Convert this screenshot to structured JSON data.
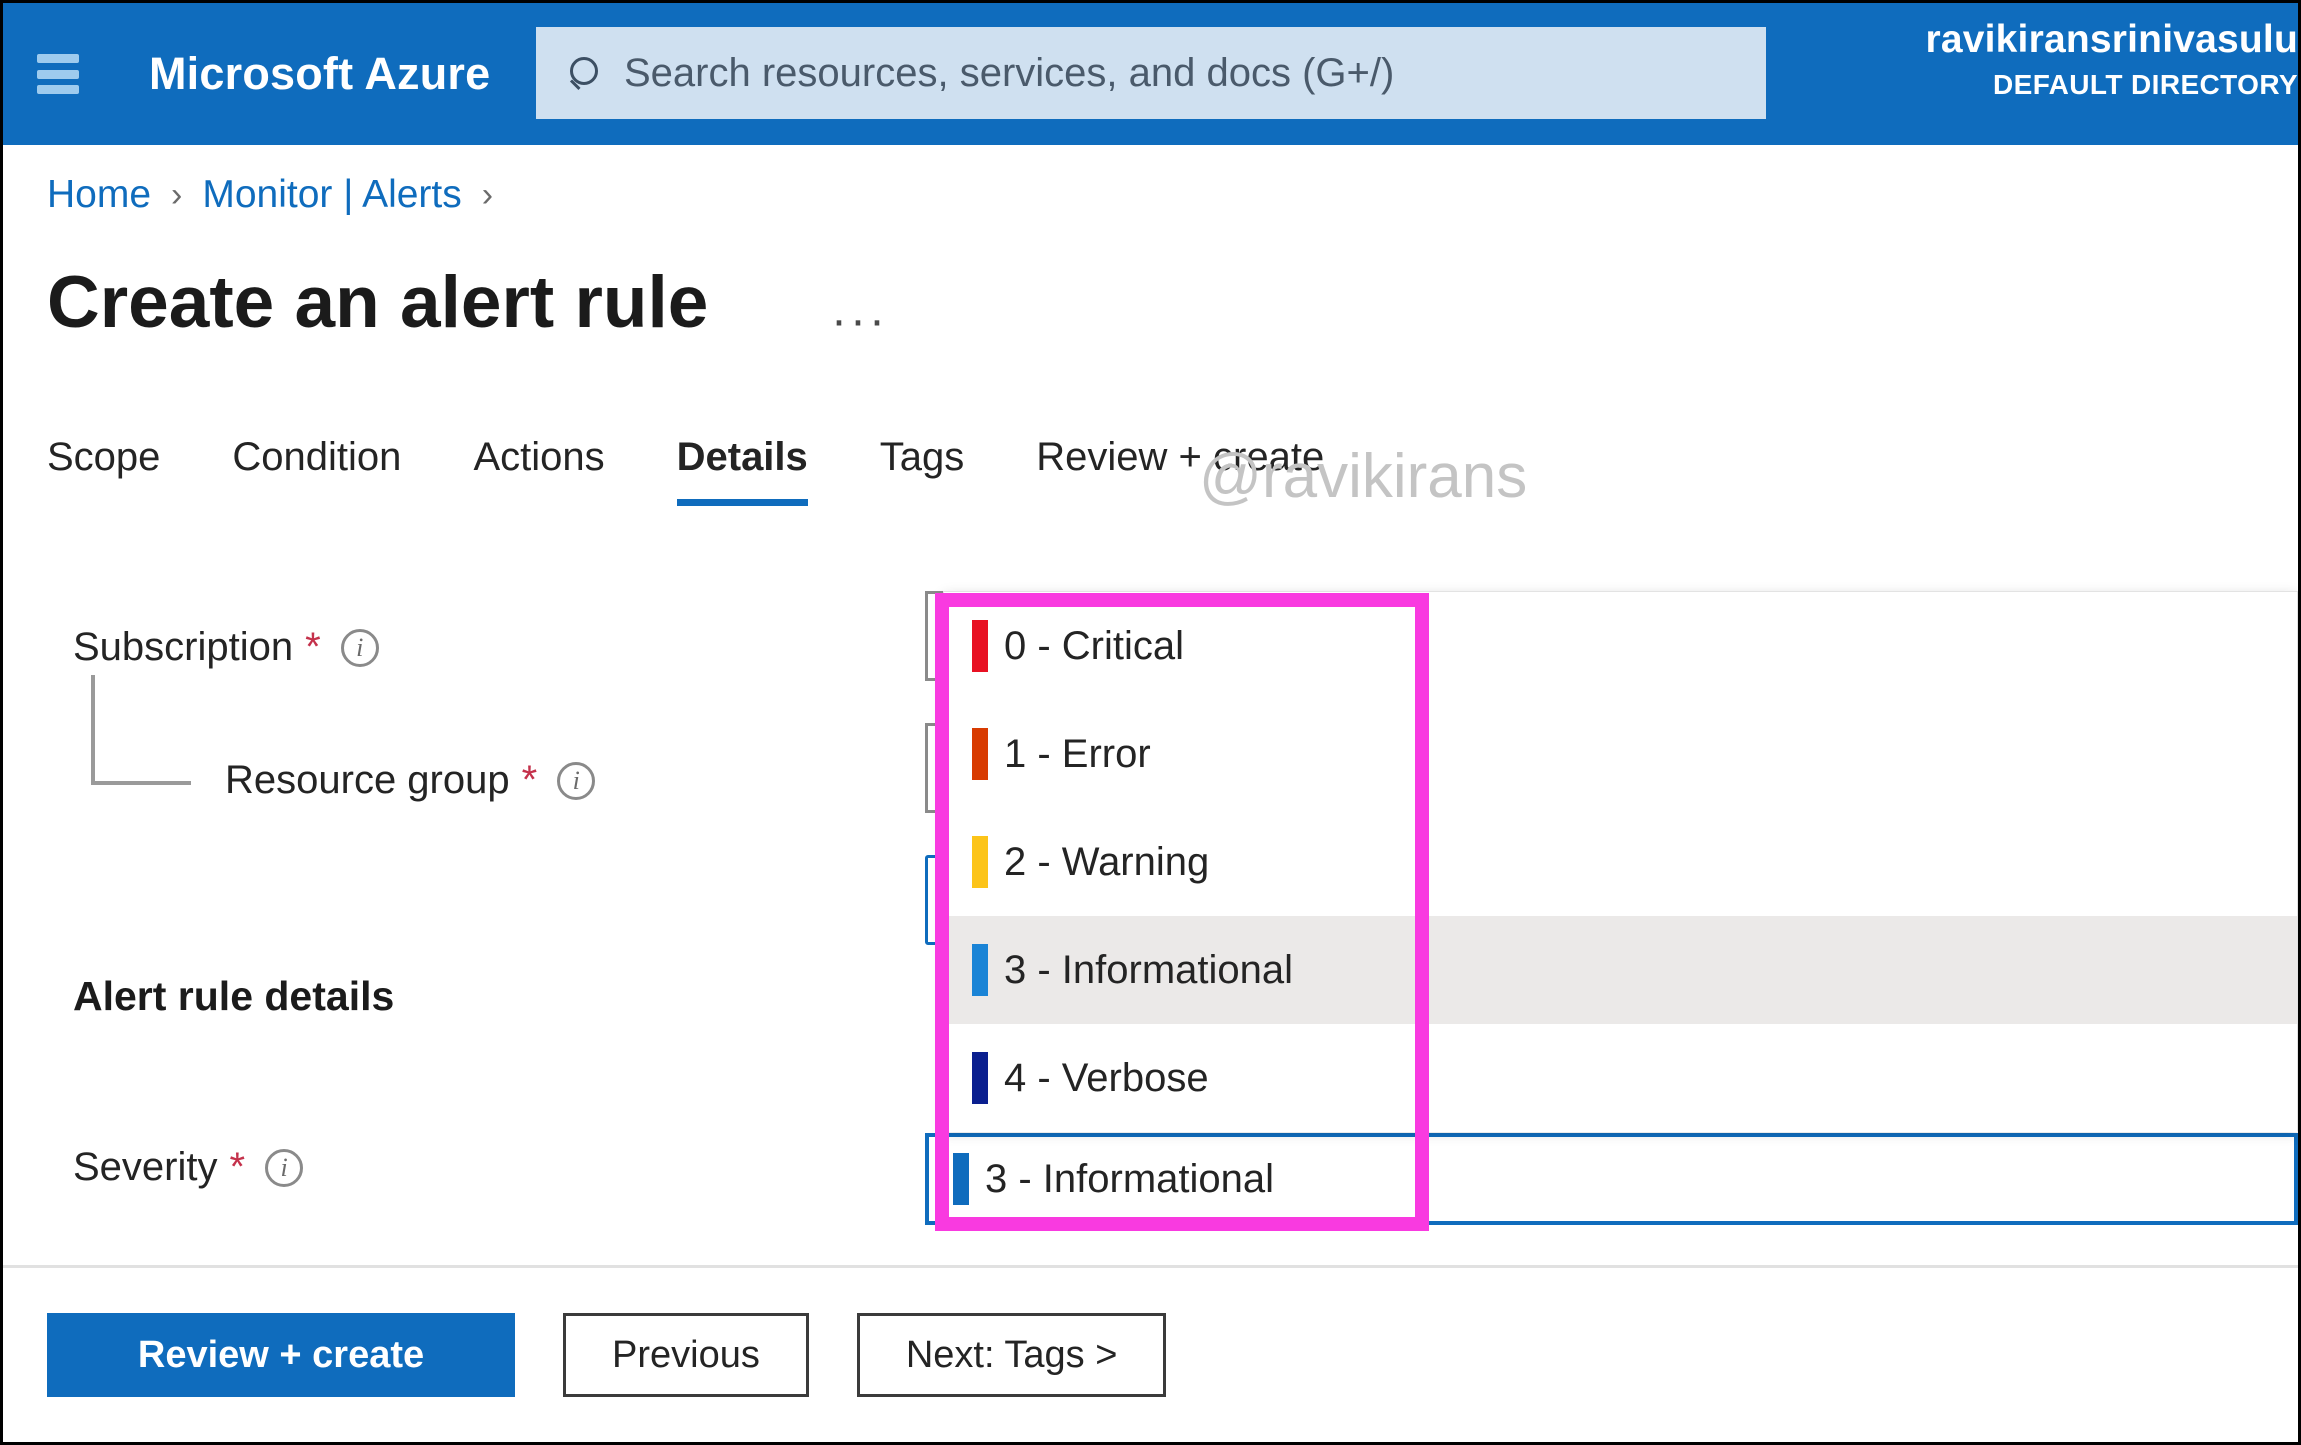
{
  "header": {
    "menu_icon": "hamburger-icon",
    "brand": "Microsoft Azure",
    "search": {
      "icon": "search-icon",
      "placeholder": "Search resources, services, and docs (G+/)"
    },
    "account": {
      "name": "ravikiransrinivasulu",
      "directory": "DEFAULT DIRECTORY"
    }
  },
  "breadcrumb": {
    "items": [
      {
        "label": "Home"
      },
      {
        "label": "Monitor | Alerts"
      }
    ],
    "separator": "›",
    "trailing_separator": "›"
  },
  "page": {
    "title": "Create an alert rule",
    "more_actions": "···"
  },
  "tabs": [
    {
      "label": "Scope",
      "active": false
    },
    {
      "label": "Condition",
      "active": false
    },
    {
      "label": "Actions",
      "active": false
    },
    {
      "label": "Details",
      "active": true
    },
    {
      "label": "Tags",
      "active": false
    },
    {
      "label": "Review + create",
      "active": false
    }
  ],
  "watermark": "@ravikirans",
  "form": {
    "subscription": {
      "label": "Subscription",
      "required_marker": "*",
      "info_icon": "info-icon"
    },
    "resource_group": {
      "label": "Resource group",
      "required_marker": "*",
      "info_icon": "info-icon"
    },
    "section_heading": "Alert rule details",
    "severity": {
      "label": "Severity",
      "required_marker": "*",
      "info_icon": "info-icon",
      "selected_value": "3 - Informational",
      "selected_color": "#0f6cbd"
    }
  },
  "severity_dropdown": {
    "open": true,
    "options": [
      {
        "label": "0 - Critical",
        "color": "#e81123",
        "hovered": false
      },
      {
        "label": "1 - Error",
        "color": "#d83b01",
        "hovered": false
      },
      {
        "label": "2 - Warning",
        "color": "#fcc419",
        "hovered": false
      },
      {
        "label": "3 - Informational",
        "color": "#1a84d6",
        "hovered": true
      },
      {
        "label": "4 - Verbose",
        "color": "#0a1f8f",
        "hovered": false
      }
    ]
  },
  "highlight": {
    "color": "#f93ae0",
    "target": "severity-dropdown"
  },
  "footer": {
    "buttons": [
      {
        "label": "Review + create",
        "style": "primary"
      },
      {
        "label": "Previous",
        "style": "secondary"
      },
      {
        "label": "Next: Tags >",
        "style": "secondary"
      }
    ]
  }
}
